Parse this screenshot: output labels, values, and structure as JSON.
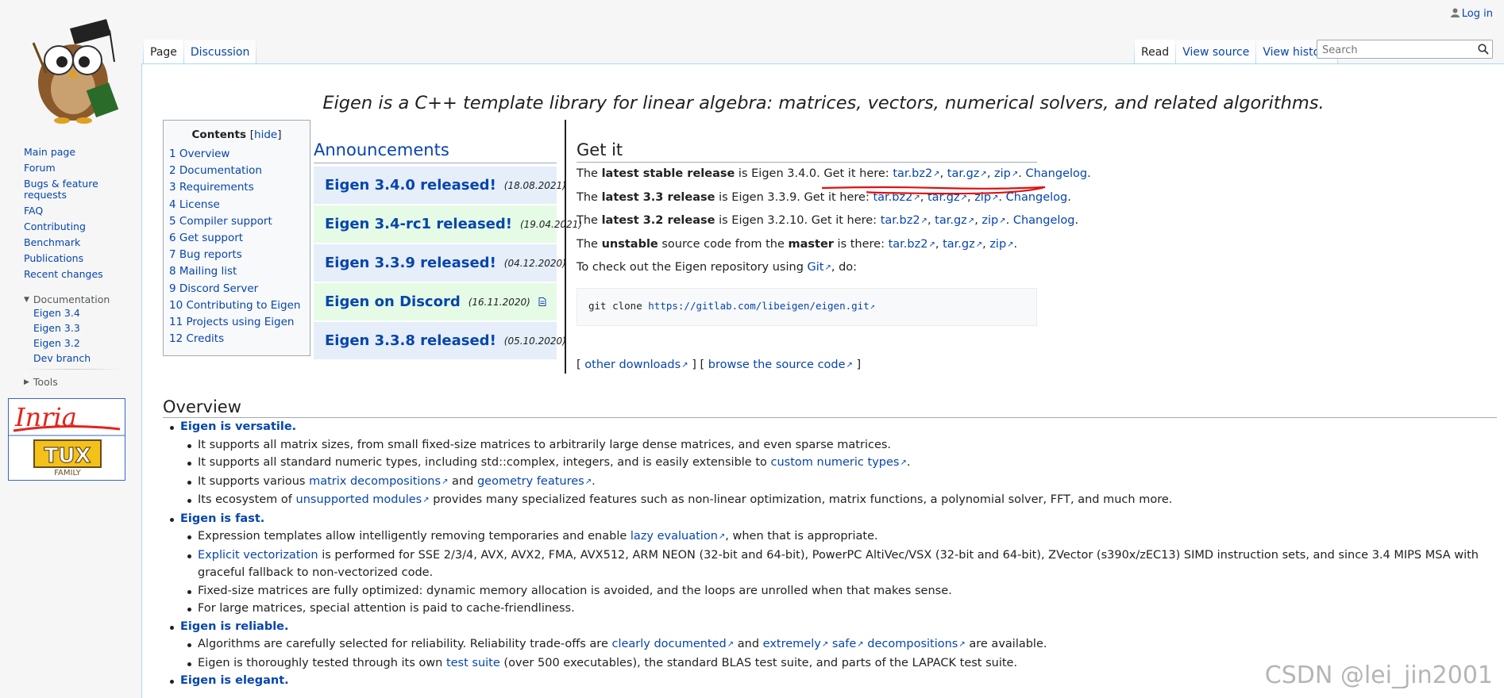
{
  "header": {
    "login_label": "Log in",
    "left_tabs": [
      "Page",
      "Discussion"
    ],
    "right_tabs": [
      "Read",
      "View source",
      "View history"
    ],
    "search_placeholder": "Search"
  },
  "sidebar": {
    "nav": [
      "Main page",
      "Forum",
      "Bugs & feature requests",
      "FAQ",
      "Contributing",
      "Benchmark",
      "Publications",
      "Recent changes"
    ],
    "documentation": {
      "label": "Documentation",
      "items": [
        "Eigen 3.4",
        "Eigen 3.3",
        "Eigen 3.2",
        "Dev branch"
      ]
    },
    "tools_label": "Tools",
    "sponsor": {
      "inria": "Inria",
      "tux": "TUX",
      "family": "FAMILY"
    }
  },
  "tagline": "Eigen is a C++ template library for linear algebra: matrices, vectors, numerical solvers, and related algorithms.",
  "toc": {
    "title": "Contents",
    "hide": "hide",
    "items": [
      {
        "num": "1",
        "label": "Overview"
      },
      {
        "num": "2",
        "label": "Documentation"
      },
      {
        "num": "3",
        "label": "Requirements"
      },
      {
        "num": "4",
        "label": "License"
      },
      {
        "num": "5",
        "label": "Compiler support"
      },
      {
        "num": "6",
        "label": "Get support"
      },
      {
        "num": "7",
        "label": "Bug reports"
      },
      {
        "num": "8",
        "label": "Mailing list"
      },
      {
        "num": "9",
        "label": "Discord Server"
      },
      {
        "num": "10",
        "label": "Contributing to Eigen"
      },
      {
        "num": "11",
        "label": "Projects using Eigen"
      },
      {
        "num": "12",
        "label": "Credits"
      }
    ]
  },
  "announcements": {
    "title": "Announcements",
    "items": [
      {
        "title": "Eigen 3.4.0 released!",
        "date": "(18.08.2021)",
        "color": "#e5eef9"
      },
      {
        "title": "Eigen 3.4-rc1 released!",
        "date": "(19.04.2021)",
        "color": "#e5fbe5"
      },
      {
        "title": "Eigen 3.3.9 released!",
        "date": "(04.12.2020)",
        "color": "#e5eef9"
      },
      {
        "title": "Eigen on Discord",
        "date": "(16.11.2020)",
        "color": "#e5fbe5"
      },
      {
        "title": "Eigen 3.3.8 released!",
        "date": "(05.10.2020)",
        "color": "#e5eef9"
      }
    ]
  },
  "getit": {
    "title": "Get it",
    "lines": [
      {
        "pre": "The ",
        "bold": "latest stable release",
        "mid": " is Eigen 3.4.0. Get it here: ",
        "links": [
          "tar.bz2",
          "tar.gz",
          "zip"
        ],
        "changelog": "Changelog"
      },
      {
        "pre": "The ",
        "bold": "latest 3.3 release",
        "mid": " is Eigen 3.3.9. Get it here: ",
        "links": [
          "tar.bz2",
          "tar.gz",
          "zip"
        ],
        "changelog": "Changelog"
      },
      {
        "pre": "The ",
        "bold": "latest 3.2 release",
        "mid": " is Eigen 3.2.10. Get it here: ",
        "links": [
          "tar.bz2",
          "tar.gz",
          "zip"
        ],
        "changelog": "Changelog"
      }
    ],
    "unstable": {
      "pre": "The ",
      "bold1": "unstable",
      "mid": " source code from the ",
      "bold2": "master",
      "post": " is there: ",
      "links": [
        "tar.bz2",
        "tar.gz",
        "zip"
      ]
    },
    "git_line": {
      "pre": "To check out the Eigen repository using ",
      "link": "Git",
      "post": ", do:"
    },
    "git_cmd": "git clone",
    "git_url": "https://gitlab.com/libeigen/eigen.git",
    "other_downloads": "other downloads",
    "browse_source": "browse the source code"
  },
  "overview": {
    "title": "Overview",
    "sections": [
      {
        "head": "Eigen is versatile.",
        "items": [
          [
            {
              "t": "It supports all matrix sizes, from small fixed-size matrices to arbitrarily large dense matrices, and even sparse matrices."
            }
          ],
          [
            {
              "t": "It supports all standard numeric types, including std::complex, integers, and is easily extensible to "
            },
            {
              "l": "custom numeric types"
            },
            {
              "t": "."
            }
          ],
          [
            {
              "t": "It supports various "
            },
            {
              "l": "matrix decompositions"
            },
            {
              "t": " and "
            },
            {
              "l": "geometry features"
            },
            {
              "t": "."
            }
          ],
          [
            {
              "t": "Its ecosystem of "
            },
            {
              "l": "unsupported modules"
            },
            {
              "t": " provides many specialized features such as non-linear optimization, matrix functions, a polynomial solver, FFT, and much more."
            }
          ]
        ]
      },
      {
        "head": "Eigen is fast.",
        "items": [
          [
            {
              "t": "Expression templates allow intelligently removing temporaries and enable "
            },
            {
              "l": "lazy evaluation"
            },
            {
              "t": ", when that is appropriate."
            }
          ],
          [
            {
              "lp": "Explicit vectorization"
            },
            {
              "t": " is performed for SSE 2/3/4, AVX, AVX2, FMA, AVX512, ARM NEON (32-bit and 64-bit), PowerPC AltiVec/VSX (32-bit and 64-bit), ZVector (s390x/zEC13) SIMD instruction sets, and since 3.4 MIPS MSA with graceful fallback to non-vectorized code."
            }
          ],
          [
            {
              "t": "Fixed-size matrices are fully optimized: dynamic memory allocation is avoided, and the loops are unrolled when that makes sense."
            }
          ],
          [
            {
              "t": "For large matrices, special attention is paid to cache-friendliness."
            }
          ]
        ]
      },
      {
        "head": "Eigen is reliable.",
        "items": [
          [
            {
              "t": "Algorithms are carefully selected for reliability. Reliability trade-offs are "
            },
            {
              "l": "clearly documented"
            },
            {
              "t": " and "
            },
            {
              "l": "extremely"
            },
            {
              "t": " "
            },
            {
              "l": "safe"
            },
            {
              "t": " "
            },
            {
              "l": "decompositions"
            },
            {
              "t": " are available."
            }
          ],
          [
            {
              "t": "Eigen is thoroughly tested through its own "
            },
            {
              "lp": "test suite"
            },
            {
              "t": " (over 500 executables), the standard BLAS test suite, and parts of the LAPACK test suite."
            }
          ]
        ]
      },
      {
        "head": "Eigen is elegant.",
        "items": []
      }
    ]
  },
  "watermark": "CSDN @lei_jin2001"
}
